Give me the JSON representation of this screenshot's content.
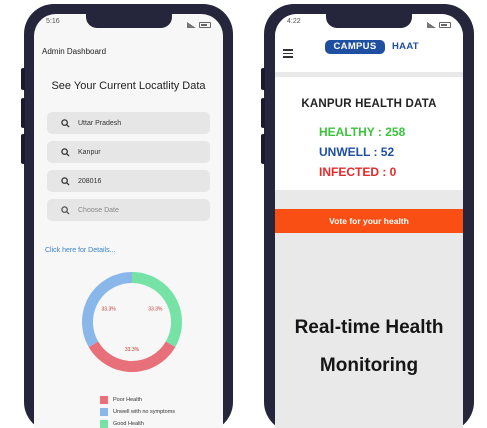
{
  "left_phone": {
    "status": {
      "time": "5:16"
    },
    "header": {
      "title": "Admin Dashboard"
    },
    "heading": "See Your Current Locatlity Data",
    "fields": [
      {
        "value": "Uttar Pradesh",
        "icon": "search-icon"
      },
      {
        "value": "Kanpur",
        "icon": "search-icon"
      },
      {
        "value": "208016",
        "icon": "search-icon"
      },
      {
        "placeholder": "Choose Date",
        "icon": "search-icon"
      }
    ],
    "details_link": "Click here for Details...",
    "chart_data": {
      "type": "pie",
      "labels": [
        "Poor Health",
        "Unwell with no symptoms",
        "Good Health"
      ],
      "values": [
        33.3,
        33.3,
        33.3
      ],
      "value_labels": [
        "33.3%",
        "33.3%",
        "33.3%"
      ],
      "colors": [
        "#e8707b",
        "#8ab7ea",
        "#76e2a6"
      ],
      "legend_position": "bottom",
      "donut": true
    }
  },
  "right_phone": {
    "status": {
      "time": "4:22"
    },
    "app": {
      "logo_campus": "CAMPUS",
      "logo_haat": "HAAT"
    },
    "health_card": {
      "title": "KANPUR HEALTH DATA",
      "healthy": "HEALTHY : 258",
      "unwell": "UNWELL : 52",
      "infected": "INFECTED : 0"
    },
    "vote_banner": "Vote for your health",
    "tagline_1": "Real-time Health",
    "tagline_2": "Monitoring"
  }
}
